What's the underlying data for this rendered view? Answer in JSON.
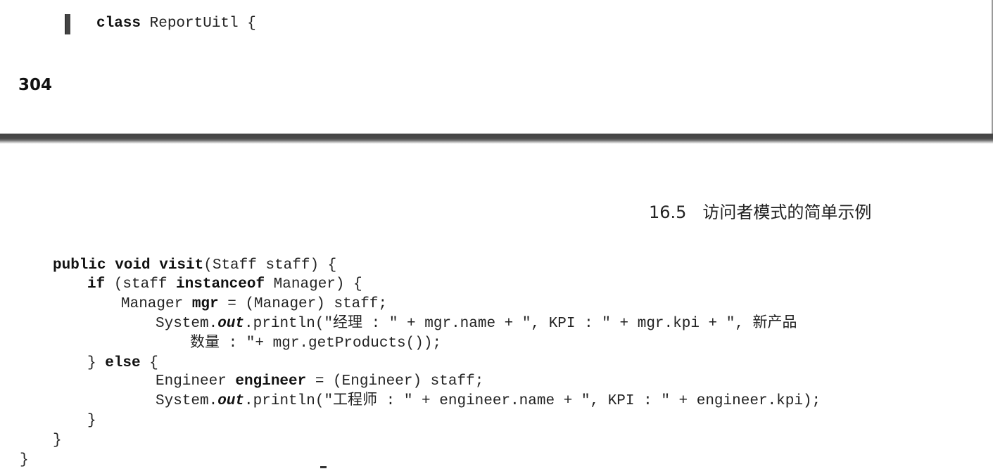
{
  "top_page": {
    "code_line": {
      "kw": "class",
      "rest": " ReportUitl {"
    },
    "page_number": "304"
  },
  "bottom_page": {
    "header": {
      "section_number": "16.5",
      "section_title": "访问者模式的简单示例"
    },
    "code": {
      "l1": {
        "kw1": "public void visit",
        "rest": "(Staff staff) {"
      },
      "l2": {
        "kw1": "if",
        "mid": " (staff ",
        "kw2": "instanceof",
        "rest": " Manager) {"
      },
      "l3": {
        "pre": "Manager ",
        "kw": "mgr",
        "rest": " = (Manager) staff;"
      },
      "l4": {
        "pre": "System.",
        "em": "out",
        "rest": ".println(\"经理 : \" + mgr.name + \", KPI : \" + mgr.kpi + \", 新产品"
      },
      "l5": {
        "text": "数量 : \"+ mgr.getProducts());"
      },
      "l6": {
        "pre": "} ",
        "kw": "else",
        "rest": " {"
      },
      "l7": {
        "pre": "Engineer ",
        "kw": "engineer",
        "rest": " = (Engineer) staff;"
      },
      "l8": {
        "pre": "System.",
        "em": "out",
        "rest": ".println(\"工程师 : \" + engineer.name + \", KPI : \" + engineer.kpi);"
      },
      "l9": {
        "text": "}"
      },
      "l10": {
        "text": "}"
      },
      "l11": {
        "text": "}"
      }
    }
  }
}
